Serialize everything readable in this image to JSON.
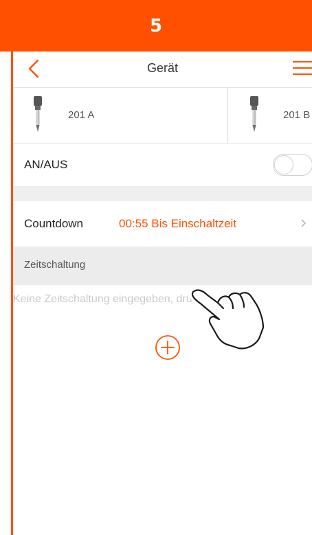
{
  "step": {
    "number": "5"
  },
  "header": {
    "title": "Gerät"
  },
  "devices": [
    {
      "label": "201 A"
    },
    {
      "label": "201 B"
    }
  ],
  "power": {
    "label": "AN/AUS",
    "state": "off"
  },
  "countdown": {
    "label": "Countdown",
    "value": "00:55 Bis Einschaltzeit"
  },
  "timer": {
    "section_label": "Zeitschaltung",
    "empty_message": "Keine Zeitschaltung eingegeben, drücken Sie auf"
  },
  "colors": {
    "accent": "#fe5000",
    "divider": "#e2e2e2",
    "section_bg": "#ececec",
    "placeholder_text": "#c9c9c9"
  },
  "icons": {
    "back": "back-chevron-icon",
    "menu": "hamburger-menu-icon",
    "device": "plug-icon",
    "row_arrow": "chevron-right-icon",
    "add": "plus-circle-icon",
    "pointer": "pointing-hand-icon"
  }
}
